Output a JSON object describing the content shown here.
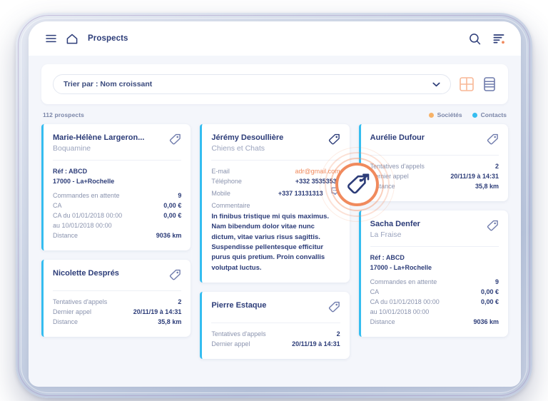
{
  "topbar": {
    "menu_icon": "hamburger-menu-icon",
    "home_icon": "home-icon",
    "title": "Prospects",
    "search_icon": "search-icon",
    "filter_icon": "filter-sort-icon"
  },
  "sortbar": {
    "sort_value": "Trier par : Nom croissant",
    "chevron_icon": "chevron-down-icon",
    "grid_view_icon": "grid-view-icon",
    "list_view_icon": "list-view-icon"
  },
  "stats": {
    "count_label": "112 prospects",
    "legend": [
      {
        "label": "Sociétés",
        "color": "#f7b267"
      },
      {
        "label": "Contacts",
        "color": "#35bdf0"
      }
    ]
  },
  "colors": {
    "accent_orange": "#f08a5d",
    "accent_blue": "#35bdf0",
    "navy": "#2c3c78",
    "muted": "#8a93ae"
  },
  "cursor": {
    "type": "tap-ripple",
    "target": "card-tag-icon"
  },
  "cards": {
    "c1": {
      "name": "Marie-Hélène Largeron...",
      "company": "Boquamine",
      "ref": "Réf : ABCD",
      "city": "17000 - La+Rochelle",
      "rows": [
        {
          "k": "Commandes en attente",
          "v": "9"
        },
        {
          "k": "CA",
          "v": "0,00 €"
        },
        {
          "k": "CA du 01/01/2018 00:00",
          "v": "0,00 €"
        }
      ],
      "row_cont": "au 10/01/2018 00:00",
      "last_row": {
        "k": "Distance",
        "v": "9036 km"
      }
    },
    "c2": {
      "name": "Nicolette Després",
      "rows": [
        {
          "k": "Tentatives d'appels",
          "v": "2"
        },
        {
          "k": "Dernier appel",
          "v": "20/11/19 à 14:31"
        },
        {
          "k": "Distance",
          "v": "35,8 km"
        }
      ]
    },
    "c3": {
      "name": "Jérémy Desoullière",
      "company": "Chiens et Chats",
      "rows": [
        {
          "k": "E-mail",
          "v": "adr@gmail.com"
        },
        {
          "k": "Téléphone",
          "v": "+332 35353535"
        },
        {
          "k": "Mobile",
          "v": "+337 13131313"
        }
      ],
      "comment_label": "Commentaire",
      "comment_text": "In finibus tristique mi quis maximus. Nam bibendum dolor vitae nunc dictum, vitae varius risus sagittis. Suspendisse pellentesque efficitur purus quis pretium. Proin convallis volutpat luctus.",
      "bubble_icon": "comment-bubble-icon"
    },
    "c4": {
      "name": "Pierre Estaque",
      "rows": [
        {
          "k": "Tentatives d'appels",
          "v": "2"
        },
        {
          "k": "Dernier appel",
          "v": "20/11/19 à 14:31"
        }
      ]
    },
    "c5": {
      "name": "Aurélie Dufour",
      "rows": [
        {
          "k": "Tentatives d'appels",
          "v": "2"
        },
        {
          "k": "Dernier appel",
          "v": "20/11/19 à 14:31"
        },
        {
          "k": "Distance",
          "v": "35,8 km"
        }
      ]
    },
    "c6": {
      "name": "Sacha Denfer",
      "company": "La Fraise",
      "ref": "Réf : ABCD",
      "city": "17000 - La+Rochelle",
      "rows": [
        {
          "k": "Commandes en attente",
          "v": "9"
        },
        {
          "k": "CA",
          "v": "0,00 €"
        },
        {
          "k": "CA du 01/01/2018 00:00",
          "v": "0,00 €"
        }
      ],
      "row_cont": "au 10/01/2018 00:00",
      "last_row": {
        "k": "Distance",
        "v": "9036 km"
      }
    }
  }
}
